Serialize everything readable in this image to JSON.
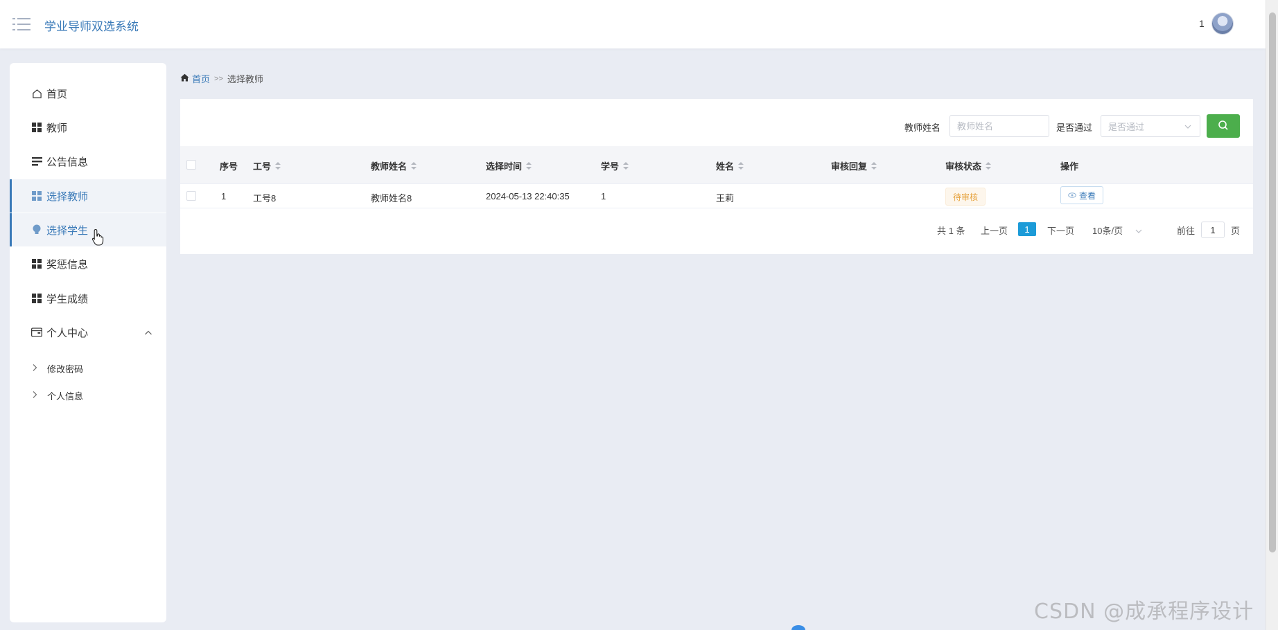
{
  "header": {
    "app_title": "学业导师双选系统",
    "user_name": "1"
  },
  "sidebar": {
    "items": [
      {
        "label": "首页",
        "icon": "home-icon"
      },
      {
        "label": "教师",
        "icon": "grid-icon"
      },
      {
        "label": "公告信息",
        "icon": "list-icon"
      },
      {
        "label": "选择教师",
        "icon": "grid-icon"
      },
      {
        "label": "选择学生",
        "icon": "bulb-icon"
      },
      {
        "label": "奖惩信息",
        "icon": "grid-icon"
      },
      {
        "label": "学生成绩",
        "icon": "grid-icon"
      },
      {
        "label": "个人中心",
        "icon": "card-icon"
      }
    ],
    "sub_items": [
      {
        "label": "修改密码"
      },
      {
        "label": "个人信息"
      }
    ]
  },
  "breadcrumb": {
    "home": "首页",
    "separator": ">>",
    "current": "选择教师"
  },
  "search": {
    "teacher_name_label": "教师姓名",
    "teacher_name_placeholder": "教师姓名",
    "passed_label": "是否通过",
    "passed_placeholder": "是否通过"
  },
  "table": {
    "columns": [
      "序号",
      "工号",
      "教师姓名",
      "选择时间",
      "学号",
      "姓名",
      "审核回复",
      "审核状态",
      "操作"
    ],
    "rows": [
      {
        "index": "1",
        "job_no": "工号8",
        "teacher_name": "教师姓名8",
        "select_time": "2024-05-13 22:40:35",
        "student_no": "1",
        "name": "王莉",
        "reply": "",
        "status": "待审核",
        "action": "查看"
      }
    ]
  },
  "pagination": {
    "total": "共 1 条",
    "prev": "上一页",
    "current_page": "1",
    "next": "下一页",
    "page_size": "10条/页",
    "goto_label": "前往",
    "goto_value": "1",
    "page_unit": "页"
  },
  "watermark": "CSDN @成承程序设计",
  "colors": {
    "accent": "#3a7ab8",
    "search_button": "#4cae4c",
    "pager_active": "#1c9bd8",
    "status_pending": "#e6a23c"
  }
}
